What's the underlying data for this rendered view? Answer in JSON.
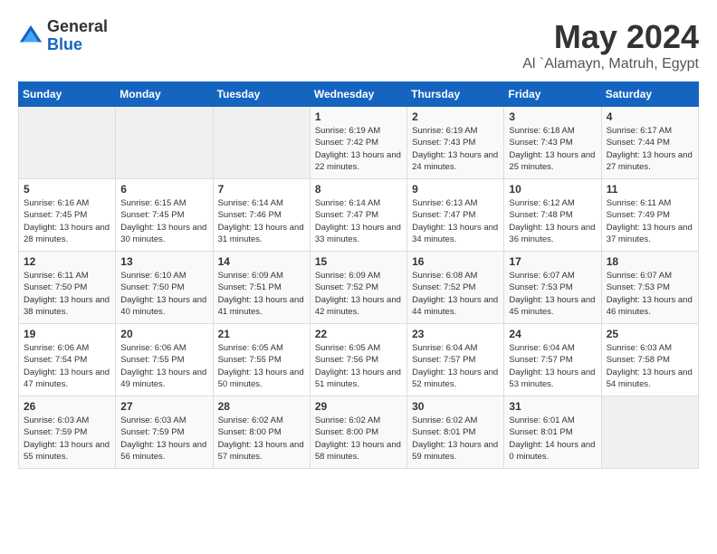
{
  "logo": {
    "general": "General",
    "blue": "Blue"
  },
  "title": "May 2024",
  "subtitle": "Al `Alamayn, Matruh, Egypt",
  "days_of_week": [
    "Sunday",
    "Monday",
    "Tuesday",
    "Wednesday",
    "Thursday",
    "Friday",
    "Saturday"
  ],
  "weeks": [
    [
      {
        "day": "",
        "info": ""
      },
      {
        "day": "",
        "info": ""
      },
      {
        "day": "",
        "info": ""
      },
      {
        "day": "1",
        "info": "Sunrise: 6:19 AM\nSunset: 7:42 PM\nDaylight: 13 hours\nand 22 minutes."
      },
      {
        "day": "2",
        "info": "Sunrise: 6:19 AM\nSunset: 7:43 PM\nDaylight: 13 hours\nand 24 minutes."
      },
      {
        "day": "3",
        "info": "Sunrise: 6:18 AM\nSunset: 7:43 PM\nDaylight: 13 hours\nand 25 minutes."
      },
      {
        "day": "4",
        "info": "Sunrise: 6:17 AM\nSunset: 7:44 PM\nDaylight: 13 hours\nand 27 minutes."
      }
    ],
    [
      {
        "day": "5",
        "info": "Sunrise: 6:16 AM\nSunset: 7:45 PM\nDaylight: 13 hours\nand 28 minutes."
      },
      {
        "day": "6",
        "info": "Sunrise: 6:15 AM\nSunset: 7:45 PM\nDaylight: 13 hours\nand 30 minutes."
      },
      {
        "day": "7",
        "info": "Sunrise: 6:14 AM\nSunset: 7:46 PM\nDaylight: 13 hours\nand 31 minutes."
      },
      {
        "day": "8",
        "info": "Sunrise: 6:14 AM\nSunset: 7:47 PM\nDaylight: 13 hours\nand 33 minutes."
      },
      {
        "day": "9",
        "info": "Sunrise: 6:13 AM\nSunset: 7:47 PM\nDaylight: 13 hours\nand 34 minutes."
      },
      {
        "day": "10",
        "info": "Sunrise: 6:12 AM\nSunset: 7:48 PM\nDaylight: 13 hours\nand 36 minutes."
      },
      {
        "day": "11",
        "info": "Sunrise: 6:11 AM\nSunset: 7:49 PM\nDaylight: 13 hours\nand 37 minutes."
      }
    ],
    [
      {
        "day": "12",
        "info": "Sunrise: 6:11 AM\nSunset: 7:50 PM\nDaylight: 13 hours\nand 38 minutes."
      },
      {
        "day": "13",
        "info": "Sunrise: 6:10 AM\nSunset: 7:50 PM\nDaylight: 13 hours\nand 40 minutes."
      },
      {
        "day": "14",
        "info": "Sunrise: 6:09 AM\nSunset: 7:51 PM\nDaylight: 13 hours\nand 41 minutes."
      },
      {
        "day": "15",
        "info": "Sunrise: 6:09 AM\nSunset: 7:52 PM\nDaylight: 13 hours\nand 42 minutes."
      },
      {
        "day": "16",
        "info": "Sunrise: 6:08 AM\nSunset: 7:52 PM\nDaylight: 13 hours\nand 44 minutes."
      },
      {
        "day": "17",
        "info": "Sunrise: 6:07 AM\nSunset: 7:53 PM\nDaylight: 13 hours\nand 45 minutes."
      },
      {
        "day": "18",
        "info": "Sunrise: 6:07 AM\nSunset: 7:53 PM\nDaylight: 13 hours\nand 46 minutes."
      }
    ],
    [
      {
        "day": "19",
        "info": "Sunrise: 6:06 AM\nSunset: 7:54 PM\nDaylight: 13 hours\nand 47 minutes."
      },
      {
        "day": "20",
        "info": "Sunrise: 6:06 AM\nSunset: 7:55 PM\nDaylight: 13 hours\nand 49 minutes."
      },
      {
        "day": "21",
        "info": "Sunrise: 6:05 AM\nSunset: 7:55 PM\nDaylight: 13 hours\nand 50 minutes."
      },
      {
        "day": "22",
        "info": "Sunrise: 6:05 AM\nSunset: 7:56 PM\nDaylight: 13 hours\nand 51 minutes."
      },
      {
        "day": "23",
        "info": "Sunrise: 6:04 AM\nSunset: 7:57 PM\nDaylight: 13 hours\nand 52 minutes."
      },
      {
        "day": "24",
        "info": "Sunrise: 6:04 AM\nSunset: 7:57 PM\nDaylight: 13 hours\nand 53 minutes."
      },
      {
        "day": "25",
        "info": "Sunrise: 6:03 AM\nSunset: 7:58 PM\nDaylight: 13 hours\nand 54 minutes."
      }
    ],
    [
      {
        "day": "26",
        "info": "Sunrise: 6:03 AM\nSunset: 7:59 PM\nDaylight: 13 hours\nand 55 minutes."
      },
      {
        "day": "27",
        "info": "Sunrise: 6:03 AM\nSunset: 7:59 PM\nDaylight: 13 hours\nand 56 minutes."
      },
      {
        "day": "28",
        "info": "Sunrise: 6:02 AM\nSunset: 8:00 PM\nDaylight: 13 hours\nand 57 minutes."
      },
      {
        "day": "29",
        "info": "Sunrise: 6:02 AM\nSunset: 8:00 PM\nDaylight: 13 hours\nand 58 minutes."
      },
      {
        "day": "30",
        "info": "Sunrise: 6:02 AM\nSunset: 8:01 PM\nDaylight: 13 hours\nand 59 minutes."
      },
      {
        "day": "31",
        "info": "Sunrise: 6:01 AM\nSunset: 8:01 PM\nDaylight: 14 hours\nand 0 minutes."
      },
      {
        "day": "",
        "info": ""
      }
    ]
  ]
}
